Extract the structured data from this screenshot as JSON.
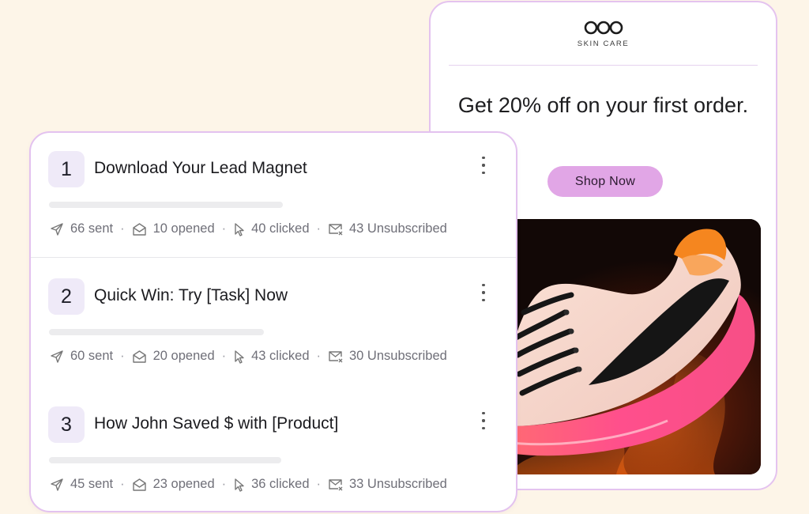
{
  "email_preview": {
    "brand_name": "SKIN CARE",
    "headline": "Get 20% off on your first order.",
    "cta_label": "Shop Now",
    "hero_image": "sneaker-product-photo",
    "colors": {
      "cta": "#e1a6e6",
      "card_border": "#e4c3ef",
      "page_background": "#fdf5e8"
    }
  },
  "sequence": {
    "steps": [
      {
        "number": "1",
        "title": "Download Your Lead Magnet",
        "sent": "66 sent",
        "opened": "10 opened",
        "clicked": "40 clicked",
        "unsubscribed": "43 Unsubscribed"
      },
      {
        "number": "2",
        "title": "Quick Win: Try [Task] Now",
        "sent": "60 sent",
        "opened": "20 opened",
        "clicked": "43 clicked",
        "unsubscribed": "30 Unsubscribed"
      },
      {
        "number": "3",
        "title": "How John Saved $ with [Product]",
        "sent": "45 sent",
        "opened": "23 opened",
        "clicked": "36 clicked",
        "unsubscribed": "33 Unsubscribed"
      }
    ],
    "stat_separator": "·",
    "icons": {
      "sent": "send-icon",
      "opened": "envelope-open-icon",
      "clicked": "cursor-icon",
      "unsubscribed": "mail-unsubscribe-icon",
      "menu": "kebab-menu-icon"
    }
  }
}
